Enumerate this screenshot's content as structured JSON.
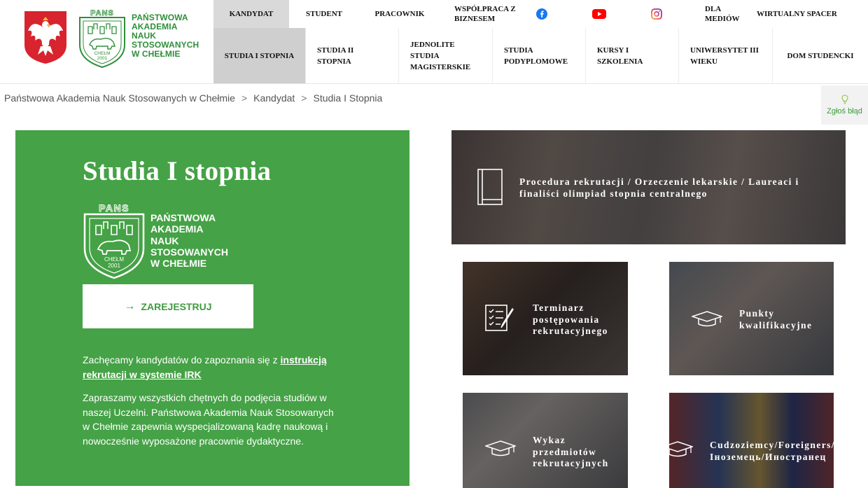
{
  "logo": {
    "name_lines": [
      "PAŃSTWOWA",
      "AKADEMIA",
      "NAUK",
      "STOSOWANYCH",
      "W CHEŁMIE"
    ]
  },
  "top_nav": {
    "items": [
      {
        "label": "KANDYDAT",
        "active": true
      },
      {
        "label": "STUDENT"
      },
      {
        "label": "PRACOWNIK"
      },
      {
        "label": "WSPÓŁPRACA Z BIZNESEM"
      },
      {
        "label": "DLA MEDIÓW"
      },
      {
        "label": "WIRTUALNY SPACER"
      }
    ],
    "social_icons": [
      "facebook-icon",
      "youtube-icon",
      "instagram-icon"
    ]
  },
  "sub_nav": {
    "items": [
      {
        "label": "STUDIA I STOPNIA",
        "active": true
      },
      {
        "label": "STUDIA II STOPNIA"
      },
      {
        "label": "JEDNOLITE STUDIA MAGISTERSKIE"
      },
      {
        "label": "STUDIA PODYPLOMOWE"
      },
      {
        "label": "KURSY I SZKOLENIA"
      },
      {
        "label": "UNIWERSYTET III WIEKU"
      },
      {
        "label": "DOM STUDENCKI"
      }
    ]
  },
  "breadcrumb": {
    "items": [
      "Państwowa Akademia Nauk Stosowanych w Chełmie",
      "Kandydat",
      "Studia I Stopnia"
    ],
    "separator": ">"
  },
  "report_error": {
    "label": "Zgłoś błąd",
    "icon": "lightbulb-icon"
  },
  "panel": {
    "title": "Studia I stopnia",
    "logo_lines": [
      "PAŃSTWOWA",
      "AKADEMIA",
      "NAUK",
      "STOSOWANYCH",
      "W CHEŁMIE"
    ],
    "register_label": "ZAREJESTRUJ",
    "intro_text": "Zachęcamy kandydatów do zapoznania się z ",
    "intro_link": "instrukcją rekrutacji w systemie IRK",
    "body_text": "Zapraszamy wszystkich chętnych do podjęcia studiów w naszej Uczelni. Państwowa Akademia Nauk Stosowanych w Chełmie zapewnia wyspecjalizowaną kadrę naukową i nowocześnie wyposażone pracownie dydaktyczne."
  },
  "tiles": {
    "main": {
      "label": "Procedura rekrutacji / Orzeczenie lekarskie / Laureaci i finaliści olimpiad stopnia centralnego",
      "icon": "book-icon"
    },
    "a": {
      "label": "Terminarz postępowania rekrutacyjnego",
      "icon": "checklist-icon"
    },
    "b": {
      "label": "Punkty kwalifikacyjne",
      "icon": "graduation-cap-icon"
    },
    "c": {
      "label": "Wykaz przedmiotów rekrutacyjnych",
      "icon": "graduation-cap-icon"
    },
    "d": {
      "label": "Cudzoziemcy/Foreigners/Іноземець/Иностранец",
      "icon": "graduation-cap-icon"
    }
  },
  "colors": {
    "brand_green": "#45a246",
    "active_nav": "#d9d9d9"
  }
}
